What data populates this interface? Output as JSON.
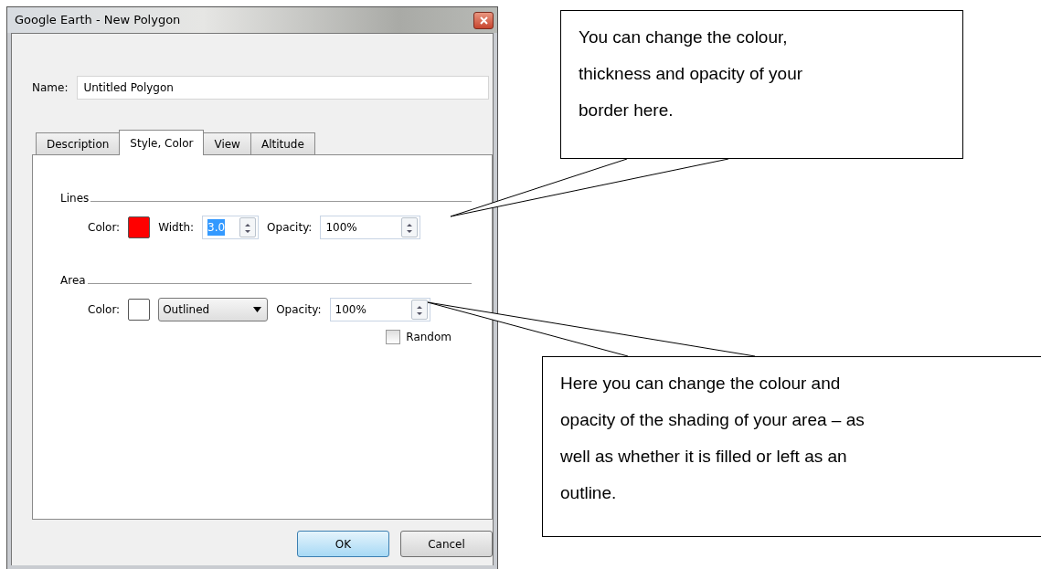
{
  "window": {
    "title": "Google Earth - New Polygon"
  },
  "name_field": {
    "label": "Name:",
    "value": "Untitled Polygon"
  },
  "tabs": [
    {
      "label": "Description",
      "selected": false
    },
    {
      "label": "Style, Color",
      "selected": true
    },
    {
      "label": "View",
      "selected": false
    },
    {
      "label": "Altitude",
      "selected": false
    }
  ],
  "lines": {
    "title": "Lines",
    "color_label": "Color:",
    "color": "#ff0000",
    "width_label": "Width:",
    "width_value": "3.0",
    "width_highlighted": true,
    "opacity_label": "Opacity:",
    "opacity_value": "100%"
  },
  "area": {
    "title": "Area",
    "color_label": "Color:",
    "color": "#ffffff",
    "fill_mode": "Outlined",
    "opacity_label": "Opacity:",
    "opacity_value": "100%",
    "random": {
      "label": "Random",
      "checked": false
    }
  },
  "buttons": [
    {
      "label": "OK",
      "default": true
    },
    {
      "label": "Cancel",
      "default": false
    }
  ],
  "callouts": [
    {
      "text": "You can change the colour, thickness and opacity of your border here."
    },
    {
      "text": "Here you can change the colour and opacity of the shading of your area – as well as whether it is filled or left as an outline."
    }
  ]
}
